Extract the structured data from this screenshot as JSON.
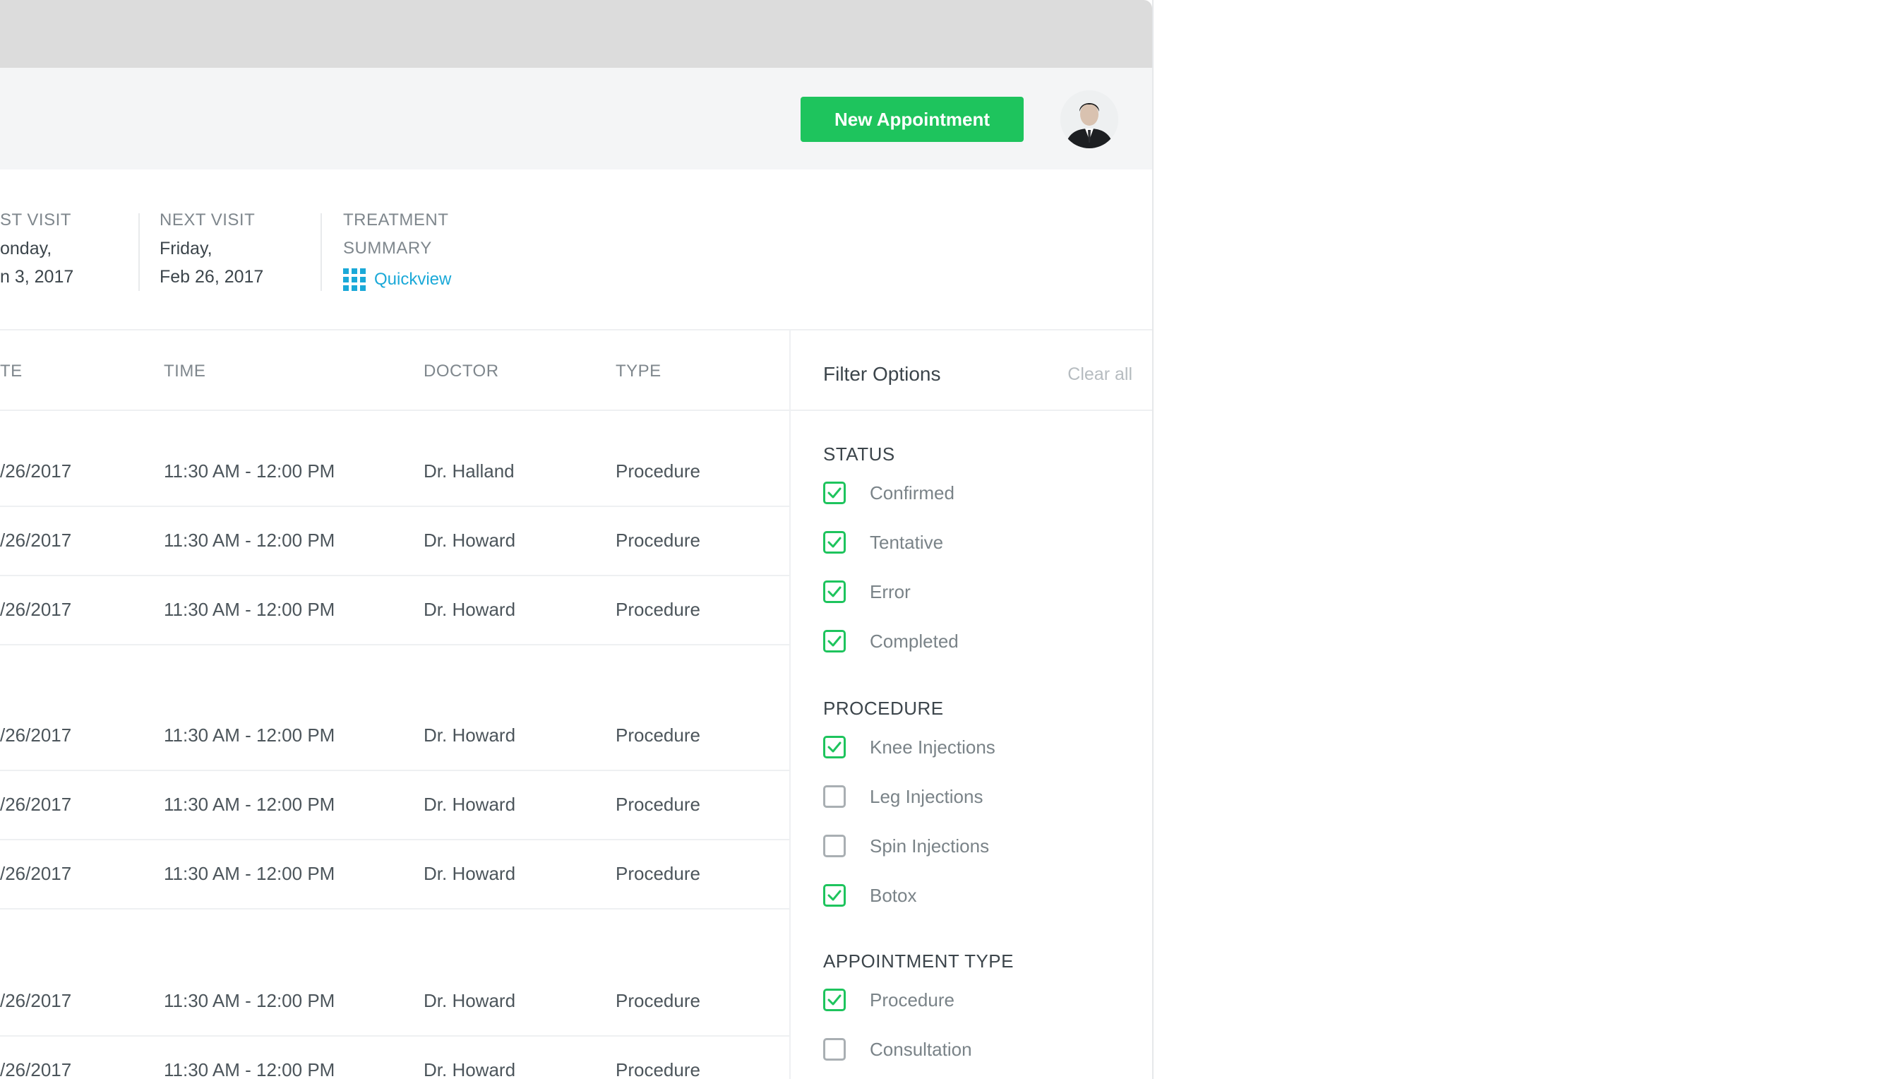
{
  "header": {
    "new_appointment_label": "New Appointment"
  },
  "info": {
    "last_visit": {
      "label": "ST VISIT",
      "line1": "onday,",
      "line2": "n 3, 2017"
    },
    "next_visit": {
      "label": "NEXT VISIT",
      "line1": "Friday,",
      "line2": "Feb 26, 2017"
    },
    "treatment_summary": {
      "label_line1": "TREATMENT",
      "label_line2": "SUMMARY",
      "link": "Quickview"
    }
  },
  "table": {
    "columns": [
      "TE",
      "TIME",
      "DOCTOR",
      "TYPE"
    ],
    "rows": [
      [
        "/26/2017",
        "11:30 AM - 12:00 PM",
        "Dr. Halland",
        "Procedure"
      ],
      [
        "/26/2017",
        "11:30 AM - 12:00 PM",
        "Dr. Howard",
        "Procedure"
      ],
      [
        "/26/2017",
        "11:30 AM - 12:00 PM",
        "Dr. Howard",
        "Procedure"
      ],
      [
        "/26/2017",
        "11:30 AM - 12:00 PM",
        "Dr. Howard",
        "Procedure"
      ],
      [
        "/26/2017",
        "11:30 AM - 12:00 PM",
        "Dr. Howard",
        "Procedure"
      ],
      [
        "/26/2017",
        "11:30 AM - 12:00 PM",
        "Dr. Howard",
        "Procedure"
      ],
      [
        "/26/2017",
        "11:30 AM - 12:00 PM",
        "Dr. Howard",
        "Procedure"
      ],
      [
        "/26/2017",
        "11:30 AM - 12:00 PM",
        "Dr. Howard",
        "Procedure"
      ]
    ]
  },
  "filter": {
    "title": "Filter Options",
    "clear_all": "Clear all",
    "sections": [
      {
        "title": "STATUS",
        "items": [
          {
            "label": "Confirmed",
            "checked": true
          },
          {
            "label": "Tentative",
            "checked": true
          },
          {
            "label": "Error",
            "checked": true
          },
          {
            "label": "Completed",
            "checked": true
          }
        ]
      },
      {
        "title": "PROCEDURE",
        "items": [
          {
            "label": "Knee Injections",
            "checked": true
          },
          {
            "label": "Leg Injections",
            "checked": false
          },
          {
            "label": "Spin Injections",
            "checked": false
          },
          {
            "label": "Botox",
            "checked": true
          }
        ]
      },
      {
        "title": "APPOINTMENT TYPE",
        "items": [
          {
            "label": "Procedure",
            "checked": true
          },
          {
            "label": "Consultation",
            "checked": false
          }
        ]
      }
    ]
  },
  "colors": {
    "accent_green": "#1ec45d",
    "link_blue": "#1ba9d8",
    "header_bg": "#f4f5f6",
    "topbar_bg": "#dcdcdc"
  }
}
